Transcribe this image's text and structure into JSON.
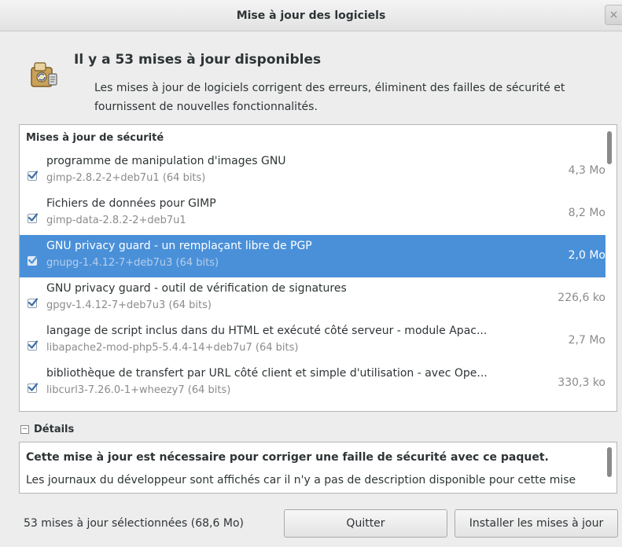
{
  "window": {
    "title": "Mise à jour des logiciels",
    "close_glyph": "×"
  },
  "header": {
    "icon": "software-update-icon",
    "headline": "Il y a 53 mises à jour disponibles",
    "description": "Les mises à jour de logiciels corrigent des erreurs, éliminent des failles de sécurité et fournissent de nouvelles fonctionnalités."
  },
  "updates": {
    "section_title": "Mises à jour de sécurité",
    "rows": [
      {
        "name": "programme de manipulation d'images GNU",
        "package": "gimp-2.8.2-2+deb7u1 (64 bits)",
        "size": "4,3 Mo",
        "checked": true,
        "selected": false
      },
      {
        "name": "Fichiers de données pour GIMP",
        "package": "gimp-data-2.8.2-2+deb7u1",
        "size": "8,2 Mo",
        "checked": true,
        "selected": false
      },
      {
        "name": "GNU privacy guard - un remplaçant libre de PGP",
        "package": "gnupg-1.4.12-7+deb7u3 (64 bits)",
        "size": "2,0 Mo",
        "checked": true,
        "selected": true
      },
      {
        "name": "GNU privacy guard - outil de vérification de signatures",
        "package": "gpgv-1.4.12-7+deb7u3 (64 bits)",
        "size": "226,6 ko",
        "checked": true,
        "selected": false
      },
      {
        "name": "langage de script inclus dans du HTML et exécuté côté serveur - module Apac...",
        "package": "libapache2-mod-php5-5.4.4-14+deb7u7 (64 bits)",
        "size": "2,7 Mo",
        "checked": true,
        "selected": false
      },
      {
        "name": "bibliothèque de transfert par URL côté client et simple d'utilisation - avec Ope...",
        "package": "libcurl3-7.26.0-1+wheezy7 (64 bits)",
        "size": "330,3 ko",
        "checked": true,
        "selected": false
      }
    ]
  },
  "details": {
    "expander_glyph": "−",
    "label": "Détails",
    "line1": "Cette mise à jour est nécessaire pour corriger une faille de sécurité avec ce paquet.",
    "line2": "Les journaux du développeur sont affichés car il n'y a pas de description disponible pour cette mise"
  },
  "footer": {
    "status": "53 mises à jour sélectionnées (68,6 Mo)",
    "quit_label": "Quitter",
    "install_label": "Installer les mises à jour"
  },
  "colors": {
    "selection": "#4a90d9",
    "window_bg": "#ededed",
    "secondary_text": "#8b8b8b"
  }
}
